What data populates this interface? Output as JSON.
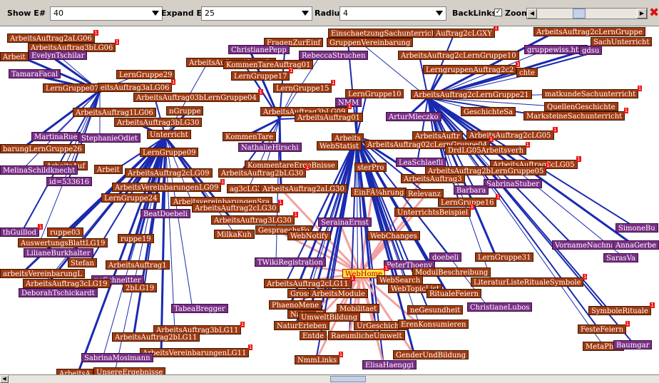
{
  "toolbar": {
    "show_label": "Show E#",
    "show_value": "40",
    "expand_label": "Expand E#",
    "expand_value": "25",
    "radius_label": "Radius",
    "radius_value": "4",
    "backlinks_label": "BackLinks",
    "backlinks_checked": "✓",
    "zoom_label": "Zoom",
    "zoom_checked": "✓",
    "close_icon": "✖"
  },
  "colors": {
    "topic": "#a13a10",
    "person": "#7a2f86",
    "selected": "#ffe23a",
    "edge": "#1a2ab0",
    "backlink_edge": "#f4a0a0"
  },
  "graph": {
    "selected": "WebHome",
    "nodes": [
      {
        "t": "EinschaetzungSachunterricht",
        "k": "br",
        "b": ""
      },
      {
        "t": "Auftrag2cLGXY",
        "k": "br",
        "b": "1"
      },
      {
        "t": "ArbeitsAuftrag2cLernGruppe",
        "k": "br",
        "b": ""
      },
      {
        "t": "ArbeitsAuftrag2aLG06",
        "k": "br",
        "b": "1"
      },
      {
        "t": "GruppenVereinbarung",
        "k": "br",
        "b": ""
      },
      {
        "t": "SachUnterricht",
        "k": "br",
        "b": ""
      },
      {
        "t": "ArbeitsAuftrag3bLG06",
        "k": "br",
        "b": "1"
      },
      {
        "t": "FragenZurEinf",
        "k": "br",
        "b": ""
      },
      {
        "t": "ChristianePepp",
        "k": "pu",
        "b": ""
      },
      {
        "t": "gruppewiss.htm",
        "k": "pu",
        "b": ""
      },
      {
        "t": "gdsu",
        "k": "pu",
        "b": ""
      },
      {
        "t": "EvelynTschilar",
        "k": "pu",
        "b": ""
      },
      {
        "t": "RebeccaStruchen",
        "k": "pu",
        "b": ""
      },
      {
        "t": "ArbeitsAuftrag2cLernGruppe10",
        "k": "br",
        "b": ""
      },
      {
        "t": "Arbeit",
        "k": "br",
        "b": ""
      },
      {
        "t": "ArbeitsAuftrag1LernGr",
        "k": "br",
        "b": ""
      },
      {
        "t": "KommenTareAuftrag01",
        "k": "br",
        "b": ""
      },
      {
        "t": "TamaraFacal",
        "k": "pu",
        "b": ""
      },
      {
        "t": "LernGruppe29",
        "k": "br",
        "b": ""
      },
      {
        "t": "LernGruppe17",
        "k": "br",
        "b": "1"
      },
      {
        "t": "LerngruppenAuftrag2c2",
        "k": "br",
        "b": "1"
      },
      {
        "t": "chte",
        "k": "br",
        "b": ""
      },
      {
        "t": "LernGruppe07",
        "k": "br",
        "b": ""
      },
      {
        "t": "eitsAuftrag3aLG06",
        "k": "br",
        "b": "1"
      },
      {
        "t": "LernGruppe15",
        "k": "br",
        "b": "1"
      },
      {
        "t": "LernGruppe10",
        "k": "br",
        "b": ""
      },
      {
        "t": "ArbeitsAuftrag2cLernGruppe21",
        "k": "br",
        "b": ""
      },
      {
        "t": "matkundeSachunterricht",
        "k": "br",
        "b": "1"
      },
      {
        "t": "ArbeitsAuftrag03bLernGruppe04",
        "k": "br",
        "b": "1"
      },
      {
        "t": "NMM",
        "k": "pu",
        "b": ""
      },
      {
        "t": "QuellenGeschichte",
        "k": "br",
        "b": ""
      },
      {
        "t": "ArbeitsAuftrag1LG06",
        "k": "br",
        "b": ""
      },
      {
        "t": "nGruppe",
        "k": "br",
        "b": ""
      },
      {
        "t": "ArbeitsAuftrag3bLG09",
        "k": "br",
        "b": "1"
      },
      {
        "t": "ArbeitsAuftrag01",
        "k": "br",
        "b": ""
      },
      {
        "t": "ArturMleczko",
        "k": "pu",
        "b": ""
      },
      {
        "t": "GeschichteSa",
        "k": "br",
        "b": ""
      },
      {
        "t": "MarksteineSachunterricht",
        "k": "br",
        "b": "1"
      },
      {
        "t": "ArbeitsAuftrag3bLG30",
        "k": "br",
        "b": ""
      },
      {
        "t": "MartinaRue",
        "k": "pu",
        "b": ""
      },
      {
        "t": "Unterricht",
        "k": "br",
        "b": ""
      },
      {
        "t": "KommenTare",
        "k": "br",
        "b": ""
      },
      {
        "t": "Arbeits",
        "k": "br",
        "b": ""
      },
      {
        "t": "ArbeitsAuftr",
        "k": "br",
        "b": ""
      },
      {
        "t": "ArbeitsAuftrag2cLG05",
        "k": "br",
        "b": "1"
      },
      {
        "t": "StephanieOdiet",
        "k": "pu",
        "b": ""
      },
      {
        "t": "ArbeitsAuftrag02cLernGruppe04",
        "k": "br",
        "b": "1"
      },
      {
        "t": "barungLernGruppe26",
        "k": "br",
        "b": ""
      },
      {
        "t": "NathalieHirschi",
        "k": "pu",
        "b": ""
      },
      {
        "t": "WebStatist",
        "k": "br",
        "b": ""
      },
      {
        "t": "DrdLG05Arbeitsverh",
        "k": "br",
        "b": "1"
      },
      {
        "t": "LernGruppe09",
        "k": "br",
        "b": ""
      },
      {
        "t": "LeaSchlaefli",
        "k": "pu",
        "b": ""
      },
      {
        "t": "ArbeitsAuftrag3cLG05",
        "k": "br",
        "b": "1"
      },
      {
        "t": "ArbeitsAuf",
        "k": "br",
        "b": ""
      },
      {
        "t": "Arbeit",
        "k": "br",
        "b": ""
      },
      {
        "t": "ArbeitsAuftrag2cLG09",
        "k": "br",
        "b": ""
      },
      {
        "t": "KommentareErgeBnisse",
        "k": "br",
        "b": ""
      },
      {
        "t": "sterPro",
        "k": "br",
        "b": ""
      },
      {
        "t": "ArbeitsAuftrag2bLernGruppe05",
        "k": "br",
        "b": "1"
      },
      {
        "t": "MelinaSchildknecht",
        "k": "pu",
        "b": ""
      },
      {
        "t": "ArbeitsAuftrag2bLG30",
        "k": "br",
        "b": "1"
      },
      {
        "t": "ArbeitsAuftrag3",
        "k": "br",
        "b": ""
      },
      {
        "t": "SabrinaStuber",
        "k": "pu",
        "b": ""
      },
      {
        "t": "id=533616",
        "k": "pu",
        "b": ""
      },
      {
        "t": "ArbeitsVereinbarungenLG09",
        "k": "br",
        "b": "1"
      },
      {
        "t": "ag3cLG30",
        "k": "br",
        "b": ""
      },
      {
        "t": "Barbara",
        "k": "pu",
        "b": ""
      },
      {
        "t": "ArbeitsAuftrag2aLG30",
        "k": "br",
        "b": ""
      },
      {
        "t": "EinFÃ¼hrung",
        "k": "br",
        "b": ""
      },
      {
        "t": "Relevanz",
        "k": "br",
        "b": ""
      },
      {
        "t": "LernGruppe24",
        "k": "br",
        "b": ""
      },
      {
        "t": "ArbeitsvereinbarungenSra",
        "k": "br",
        "b": ""
      },
      {
        "t": "LernGruppe16",
        "k": "br",
        "b": "1"
      },
      {
        "t": "ArbeitsAuftrag2cLG30",
        "k": "br",
        "b": "1"
      },
      {
        "t": "UnterrichtsBeispiel",
        "k": "br",
        "b": "1"
      },
      {
        "t": "BeatDoebeli",
        "k": "pu",
        "b": ""
      },
      {
        "t": "ArbeitsAuftrag3LG30",
        "k": "br",
        "b": "1"
      },
      {
        "t": "SerainaErnst",
        "k": "pu",
        "b": ""
      },
      {
        "t": "thGuillod",
        "k": "pu",
        "b": "1"
      },
      {
        "t": "ruppe03",
        "k": "br",
        "b": ""
      },
      {
        "t": "GespraechsFo",
        "k": "br",
        "b": ""
      },
      {
        "t": "SimoneBu",
        "k": "pu",
        "b": ""
      },
      {
        "t": "ruppe19",
        "k": "br",
        "b": ""
      },
      {
        "t": "MilkaKuh",
        "k": "br",
        "b": ""
      },
      {
        "t": "WebNotify",
        "k": "br",
        "b": ""
      },
      {
        "t": "WebChanges",
        "k": "br",
        "b": ""
      },
      {
        "t": "AuswertungsBlattLG19",
        "k": "br",
        "b": ""
      },
      {
        "t": "VornameNachname",
        "k": "pu",
        "b": ""
      },
      {
        "t": "AnnaGerbe",
        "k": "pu",
        "b": ""
      },
      {
        "t": "LilianeBurkhalter",
        "k": "pu",
        "b": ""
      },
      {
        "t": "doebeli",
        "k": "pu",
        "b": ""
      },
      {
        "t": "LernGruppe31",
        "k": "br",
        "b": ""
      },
      {
        "t": "SarasVa",
        "k": "pu",
        "b": ""
      },
      {
        "t": "Stefan",
        "k": "br",
        "b": ""
      },
      {
        "t": "ArbeitsAuftrag1",
        "k": "br",
        "b": ""
      },
      {
        "t": "TWikiRegistration",
        "k": "pu",
        "b": ""
      },
      {
        "t": "PeterThoeny",
        "k": "pu",
        "b": ""
      },
      {
        "t": "arbeitsVereinbarungL",
        "k": "br",
        "b": ""
      },
      {
        "t": "neSchneitter",
        "k": "pu",
        "b": ""
      },
      {
        "t": "WebHome",
        "k": "sel",
        "b": "1"
      },
      {
        "t": "ModulBeschreibung",
        "k": "br",
        "b": ""
      },
      {
        "t": "ArbeitsAuftrag3cLG19",
        "k": "br",
        "b": ""
      },
      {
        "t": "2bLG19",
        "k": "br",
        "b": ""
      },
      {
        "t": "WebSearch",
        "k": "br",
        "b": ""
      },
      {
        "t": "LiteraturListeRitualeSymbole",
        "k": "br",
        "b": "1"
      },
      {
        "t": "ArbeitsAuftrag2cLG11",
        "k": "br",
        "b": "1"
      },
      {
        "t": "DeborahTschickardt",
        "k": "pu",
        "b": ""
      },
      {
        "t": "GrosseFragen",
        "k": "br",
        "b": ""
      },
      {
        "t": "WebTopicList",
        "k": "br",
        "b": ""
      },
      {
        "t": "RitualeFeiern",
        "k": "br",
        "b": ""
      },
      {
        "t": "TabeaBregger",
        "k": "pu",
        "b": ""
      },
      {
        "t": "ArbeitsModule",
        "k": "br",
        "b": ""
      },
      {
        "t": "PhaenoMene",
        "k": "br",
        "b": ""
      },
      {
        "t": "ChristianeLubos",
        "k": "pu",
        "b": ""
      },
      {
        "t": "SymboleRituale",
        "k": "br",
        "b": "1"
      },
      {
        "t": "NatureEl",
        "k": "br",
        "b": ""
      },
      {
        "t": "Mobilitaet",
        "k": "br",
        "b": ""
      },
      {
        "t": "neGesundheit",
        "k": "br",
        "b": ""
      },
      {
        "t": "UmweltBildung",
        "k": "br",
        "b": ""
      },
      {
        "t": "ArbeitsAuftrag3bLG11",
        "k": "br",
        "b": "1"
      },
      {
        "t": "NaturErleben",
        "k": "br",
        "b": ""
      },
      {
        "t": "UrGeschichte",
        "k": "br",
        "b": ""
      },
      {
        "t": "ErenKonsumieren",
        "k": "br",
        "b": ""
      },
      {
        "t": "FesteFeiern",
        "k": "br",
        "b": "1"
      },
      {
        "t": "ArbeitsAuftrag2bLG11",
        "k": "br",
        "b": ""
      },
      {
        "t": "Entde",
        "k": "br",
        "b": ""
      },
      {
        "t": "RaeumlicheUmwelt",
        "k": "br",
        "b": ""
      },
      {
        "t": "ArbeitsVereinbarungenLG11",
        "k": "br",
        "b": "1"
      },
      {
        "t": "MetaPher",
        "k": "br",
        "b": ""
      },
      {
        "t": "Baumgar",
        "k": "pu",
        "b": ""
      },
      {
        "t": "GenderUndBildung",
        "k": "br",
        "b": ""
      },
      {
        "t": "SabrinaMosimann",
        "k": "pu",
        "b": ""
      },
      {
        "t": "NmmLinks",
        "k": "br",
        "b": "1"
      },
      {
        "t": "ArbeitsA",
        "k": "br",
        "b": ""
      },
      {
        "t": "UnsereErgebnisse",
        "k": "br",
        "b": ""
      },
      {
        "t": "ElisaHaenggi",
        "k": "pu",
        "b": ""
      }
    ]
  }
}
